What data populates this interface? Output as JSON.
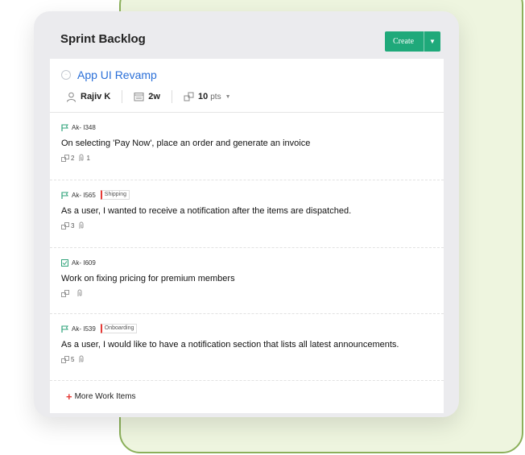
{
  "panel": {
    "title": "Sprint Backlog",
    "create_button": "Create",
    "create_dropdown_icon": "chevron-down-icon"
  },
  "epic": {
    "title": "App UI Revamp",
    "assignee": "Rajiv K",
    "duration": "2w",
    "points_value": "10",
    "points_unit": "pts"
  },
  "items": [
    {
      "id": "Ak- I348",
      "tag": "",
      "summary": "On selecting 'Pay Now', place an order and generate an invoice",
      "points": "2",
      "attachments": "1",
      "icon": "flag-icon"
    },
    {
      "id": "Ak- I565",
      "tag": "Shipping",
      "summary": "As a user, I wanted to receive a notification after the items are dispatched.",
      "points": "3",
      "attachments": "",
      "icon": "flag-icon"
    },
    {
      "id": "Ak- I609",
      "tag": "",
      "summary": "Work on fixing pricing for premium members",
      "points": "",
      "attachments": "",
      "icon": "task-checkbox-icon"
    },
    {
      "id": "Ak- I539",
      "tag": "Onboarding",
      "summary": "As a user, I would like to have a notification section that lists all latest announcements.",
      "points": "5",
      "attachments": "",
      "icon": "flag-icon"
    }
  ],
  "more_link": "More Work Items",
  "colors": {
    "create_button": "#1fa97a",
    "epic_title": "#2a6fd8",
    "tag_accent": "#e53935",
    "outer_panel": "#eef5df",
    "outer_panel_border": "#8bb05a"
  }
}
